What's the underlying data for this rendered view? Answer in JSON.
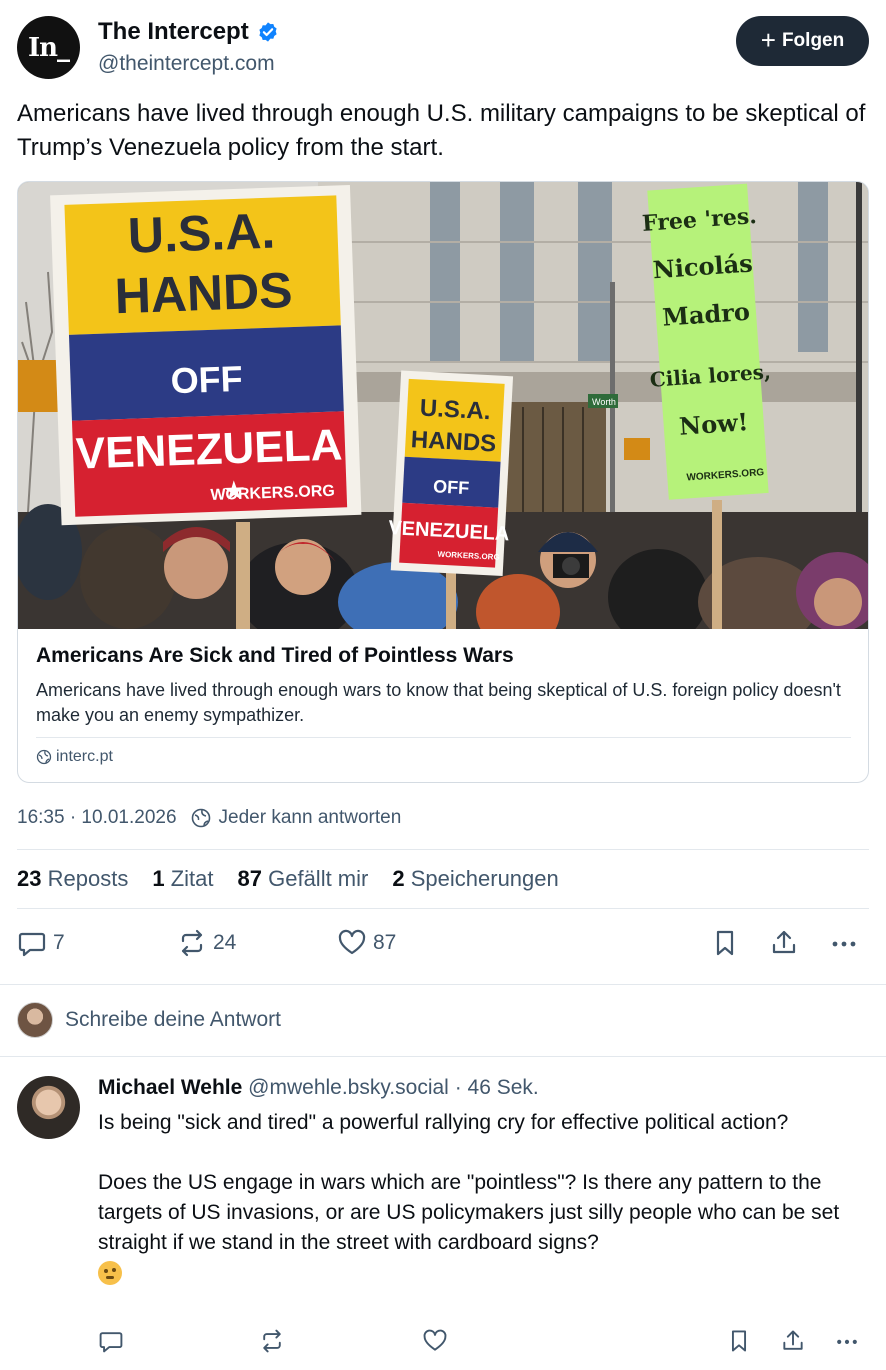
{
  "author": {
    "name": "The Intercept",
    "handle": "@theintercept.com",
    "avatar_text": "In_"
  },
  "follow_label": "Folgen",
  "post_text": "Americans have lived through enough U.S. military campaigns to be skeptical of Trump’s Venezuela policy from the start.",
  "card": {
    "image": {
      "sign_big_line1": "U.S.A.",
      "sign_big_line2": "HANDS",
      "sign_big_line3": "OFF",
      "sign_big_line4": "VENEZUELA",
      "sign_big_footer": "WORKERS.ORG",
      "sign_small_line1": "U.S.A.",
      "sign_small_line2": "HANDS",
      "sign_small_line3": "OFF",
      "sign_small_line4": "VENEZUELA",
      "sign_small_footer": "WORKERS.ORG",
      "sign_green_line1": "Free 'res.",
      "sign_green_line2": "Nicolás",
      "sign_green_line3": "Madro",
      "sign_green_line4": "Cilia lores,",
      "sign_green_line5": "Now!",
      "sign_green_footer": "WORKERS.ORG",
      "street_sign": "Worth"
    },
    "title": "Americans Are Sick and Tired of Pointless Wars",
    "description": "Americans have lived through enough wars to know that being skeptical of U.S. foreign policy doesn't make you an enemy sympathizer.",
    "domain": "interc.pt"
  },
  "meta": {
    "timestamp": "16:35 · 10.01.2026",
    "reply_permission": "Jeder kann antworten"
  },
  "stats": [
    {
      "count": "23",
      "label": "Reposts"
    },
    {
      "count": "1",
      "label": "Zitat"
    },
    {
      "count": "87",
      "label": "Gefällt mir"
    },
    {
      "count": "2",
      "label": "Speicherungen"
    }
  ],
  "actions": {
    "replies": "7",
    "reposts": "24",
    "likes": "87"
  },
  "compose_placeholder": "Schreibe deine Antwort",
  "reply": {
    "name": "Michael Wehle",
    "handle": "@mwehle.bsky.social",
    "time": "· 46 Sek.",
    "para1": "Is being \"sick and tired\" a powerful rallying cry for effective political action?",
    "para2": "Does the US engage in wars which are \"pointless\"? Is there any pattern to the targets of US invasions, or are US policymakers just silly people who can be set straight if we stand in the street with cardboard signs?",
    "emoji": "thinking-face-emoji"
  },
  "colors": {
    "follow_bg": "#1e2936",
    "verified": "#1083fe",
    "muted_text": "#42576c",
    "divider": "#e3e8ed"
  }
}
